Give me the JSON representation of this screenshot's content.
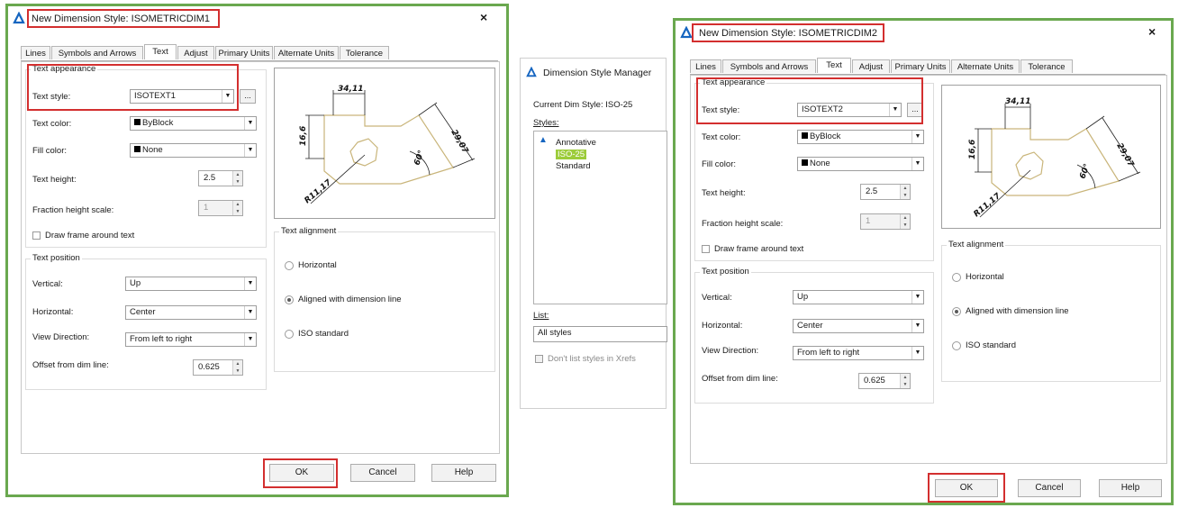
{
  "dialog1": {
    "title": "New Dimension Style: ISOMETRICDIM1",
    "close": "×",
    "tabs": [
      "Lines",
      "Symbols and Arrows",
      "Text",
      "Adjust",
      "Primary Units",
      "Alternate Units",
      "Tolerance"
    ],
    "active_tab": "Text",
    "text_appearance": {
      "group_label": "Text appearance",
      "text_style_label": "Text style:",
      "text_style_value": "ISOTEXT1",
      "ellipsis": "...",
      "text_color_label": "Text color:",
      "text_color_value": "ByBlock",
      "fill_color_label": "Fill color:",
      "fill_color_value": "None",
      "text_height_label": "Text height:",
      "text_height_value": "2.5",
      "fraction_label": "Fraction height scale:",
      "fraction_value": "1",
      "frame_label": "Draw frame around text"
    },
    "text_position": {
      "group_label": "Text position",
      "vertical_label": "Vertical:",
      "vertical_value": "Up",
      "horizontal_label": "Horizontal:",
      "horizontal_value": "Center",
      "view_label": "View Direction:",
      "view_value": "From left to right",
      "offset_label": "Offset from dim line:",
      "offset_value": "0.625"
    },
    "text_alignment": {
      "group_label": "Text alignment",
      "options": [
        "Horizontal",
        "Aligned with dimension line",
        "ISO standard"
      ],
      "selected": "Aligned with dimension line"
    },
    "preview": {
      "dims": [
        "34,11",
        "16,6",
        "29,07",
        "60°",
        "R11,17"
      ]
    },
    "buttons": {
      "ok": "OK",
      "cancel": "Cancel",
      "help": "Help"
    }
  },
  "dsm": {
    "title": "Dimension Style Manager",
    "current": "Current Dim Style: ISO-25",
    "styles_label": "Styles:",
    "styles": [
      "Annotative",
      "ISO-25",
      "Standard"
    ],
    "selected_style": "ISO-25",
    "list_label": "List:",
    "list_value": "All styles",
    "xrefs_label": "Don't list styles in Xrefs"
  },
  "dialog2": {
    "title": "New Dimension Style: ISOMETRICDIM2",
    "close": "×",
    "tabs": [
      "Lines",
      "Symbols and Arrows",
      "Text",
      "Adjust",
      "Primary Units",
      "Alternate Units",
      "Tolerance"
    ],
    "active_tab": "Text",
    "text_appearance": {
      "group_label": "Text appearance",
      "text_style_label": "Text style:",
      "text_style_value": "ISOTEXT2",
      "ellipsis": "...",
      "text_color_label": "Text color:",
      "text_color_value": "ByBlock",
      "fill_color_label": "Fill color:",
      "fill_color_value": "None",
      "text_height_label": "Text height:",
      "text_height_value": "2.5",
      "fraction_label": "Fraction height scale:",
      "fraction_value": "1",
      "frame_label": "Draw frame around text"
    },
    "text_position": {
      "group_label": "Text position",
      "vertical_label": "Vertical:",
      "vertical_value": "Up",
      "horizontal_label": "Horizontal:",
      "horizontal_value": "Center",
      "view_label": "View Direction:",
      "view_value": "From left to right",
      "offset_label": "Offset from dim line:",
      "offset_value": "0.625"
    },
    "text_alignment": {
      "group_label": "Text alignment",
      "options": [
        "Horizontal",
        "Aligned with dimension line",
        "ISO standard"
      ],
      "selected": "Aligned with dimension line"
    },
    "preview": {
      "dims": [
        "34,11",
        "16,6",
        "29,07",
        "60°",
        "R11,17"
      ]
    },
    "buttons": {
      "ok": "OK",
      "cancel": "Cancel",
      "help": "Help"
    }
  },
  "colors": {
    "window_border": "#6aa84f",
    "highlight": "#d32f2f",
    "selection": "#9ccc3a",
    "icon_blue": "#1565c0"
  }
}
